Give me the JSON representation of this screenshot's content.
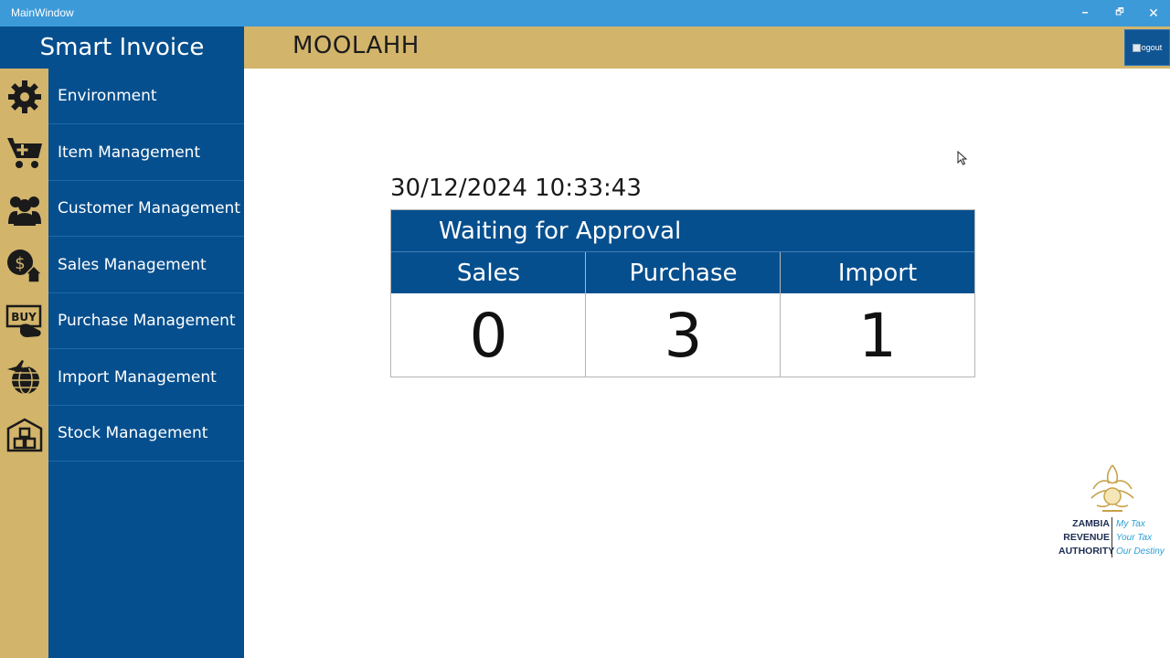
{
  "window": {
    "title": "MainWindow",
    "minimize": "🗕",
    "maximize": "🗗",
    "close": "✕"
  },
  "sidebar": {
    "brand": "Smart Invoice",
    "items": [
      {
        "label": "Environment",
        "icon": "gear-icon"
      },
      {
        "label": "Item Management",
        "icon": "cart-plus-icon"
      },
      {
        "label": "Customer Management",
        "icon": "users-icon"
      },
      {
        "label": "Sales Management",
        "icon": "dollar-house-icon"
      },
      {
        "label": "Purchase Management",
        "icon": "buy-hand-icon"
      },
      {
        "label": "Import Management",
        "icon": "globe-plane-icon"
      },
      {
        "label": "Stock Management",
        "icon": "warehouse-icon"
      }
    ]
  },
  "header": {
    "company": "MOOLAHH",
    "logout_label": "ogout"
  },
  "main": {
    "datetime": "30/12/2024 10:33:43",
    "approval": {
      "title": "Waiting for Approval",
      "columns": [
        {
          "label": "Sales",
          "value": "0"
        },
        {
          "label": "Purchase",
          "value": "3"
        },
        {
          "label": "Import",
          "value": "1"
        }
      ]
    }
  },
  "logo": {
    "org_lines": [
      "ZAMBIA",
      "REVENUE",
      "AUTHORITY"
    ],
    "slogan_lines": [
      "My Tax",
      "Your Tax",
      "Our Destiny"
    ]
  },
  "colors": {
    "primary": "#064f8e",
    "accent": "#d2b46b",
    "titlebar": "#3d9ad8"
  }
}
